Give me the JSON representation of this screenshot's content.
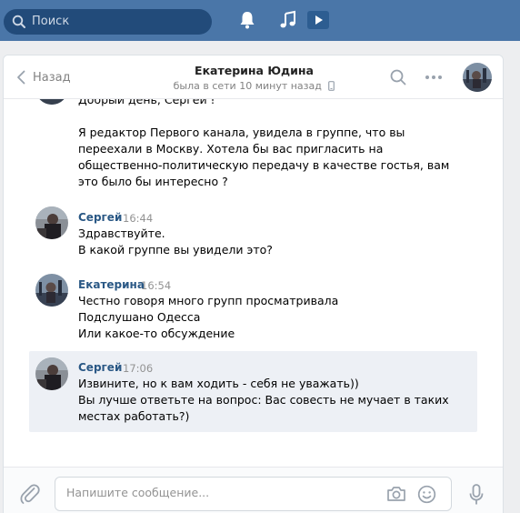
{
  "topbar": {
    "search_placeholder": "Поиск",
    "icons": [
      "search-icon",
      "bell-icon",
      "music-icon",
      "play-icon"
    ],
    "bg_color": "#4a76a8"
  },
  "header": {
    "back_label": "Назад",
    "contact_name": "Екатерина Юдина",
    "status": "была в сети 10 минут назад"
  },
  "messages": [
    {
      "author": "",
      "time": "",
      "lines": [
        "Добрый день, Сергей !",
        "",
        "Я редактор Первого канала, увидела в группе, что вы",
        "переехали в Москву. Хотела бы вас пригласить на",
        "общественно-политическую передачу в качестве гостья, вам",
        "это было бы интересно ?"
      ]
    },
    {
      "author": "Сергей",
      "time": "16:44",
      "lines": [
        "Здравствуйте.",
        "В какой группе вы увидели это?"
      ]
    },
    {
      "author": "Екатерина",
      "time": "16:54",
      "lines": [
        "Честно говоря много групп просматривала",
        "Подслушано Одесса",
        "Или какое-то обсуждение"
      ]
    },
    {
      "author": "Сергей",
      "time": "17:06",
      "lines": [
        "Извините, но к вам ходить - себя не уважать))",
        "Вы лучше ответьте на вопрос: Вас совесть не мучает в таких",
        "местах работать?)"
      ]
    }
  ],
  "composer": {
    "placeholder": "Напишите сообщение..."
  }
}
